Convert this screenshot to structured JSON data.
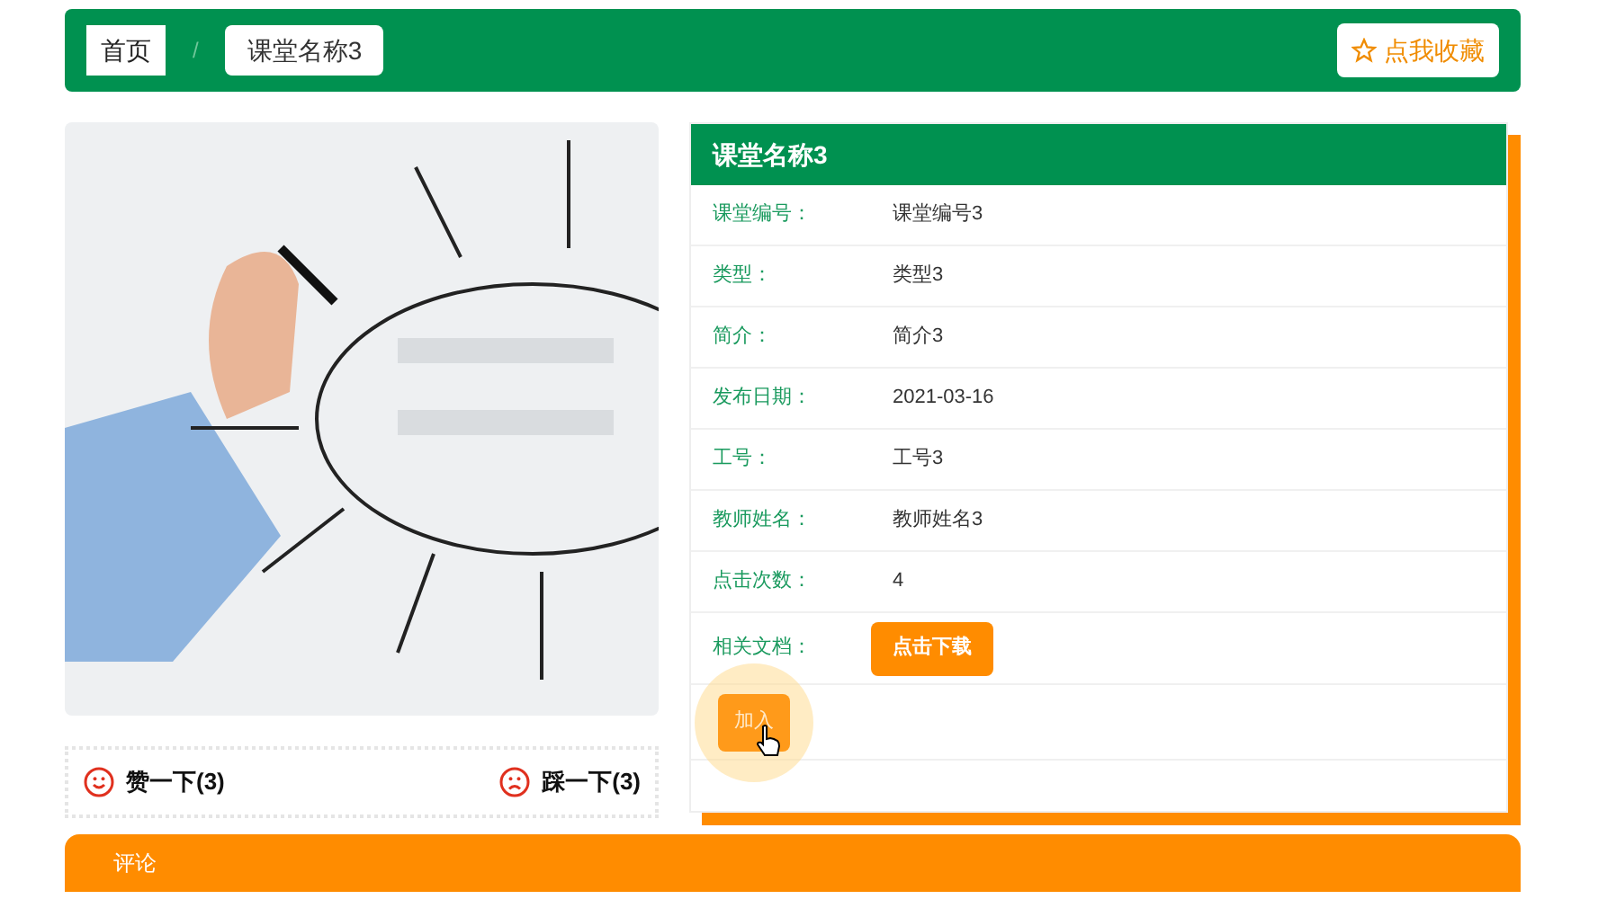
{
  "breadcrumb": [
    {
      "label": "首页"
    },
    {
      "label": "课堂名称3"
    }
  ],
  "breadcrumb_separator": "/",
  "favorite_button": "点我收藏",
  "detail": {
    "title": "课堂名称3",
    "fields": [
      {
        "label": "课堂编号：",
        "value": "课堂编号3"
      },
      {
        "label": "类型：",
        "value": "类型3"
      },
      {
        "label": "简介：",
        "value": "简介3"
      },
      {
        "label": "发布日期：",
        "value": "2021-03-16"
      },
      {
        "label": "工号：",
        "value": "工号3"
      },
      {
        "label": "教师姓名：",
        "value": "教师姓名3"
      },
      {
        "label": "点击次数：",
        "value": "4"
      }
    ],
    "document": {
      "label": "相关文档：",
      "button": "点击下载"
    },
    "join_button": "加入"
  },
  "votes": [
    {
      "kind": "like",
      "label": "赞一下(3)"
    },
    {
      "kind": "dislike",
      "label": "踩一下(3)"
    }
  ],
  "comments_tab": "评论"
}
